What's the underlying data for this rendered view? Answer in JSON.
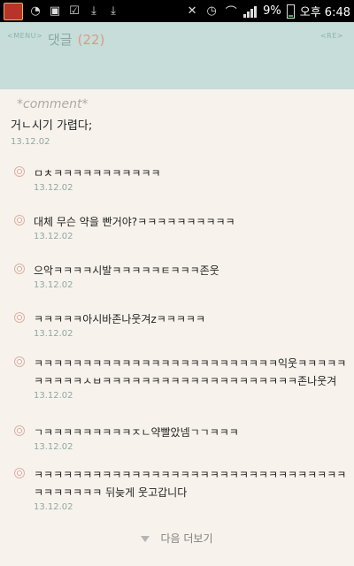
{
  "status_bar": {
    "battery": "9%",
    "time": "오후 6:48"
  },
  "header": {
    "menu_label": "<MENU>",
    "re_label": "<RE>",
    "title": "댓글",
    "count": "(22)"
  },
  "tab": {
    "label": "*comment*"
  },
  "main_post": {
    "text": "거ㄴ시기 가렵다;",
    "date": "13.12.02"
  },
  "replies": [
    {
      "text": "ㅁㅊㅋㅋㅋㅋㅋㅋㅋㅋㅋㅋㅋ",
      "date": "13.12.02"
    },
    {
      "text": "대체 무슨 약을 빤거야?ㅋㅋㅋㅋㅋㅋㅋㅋㅋㅋ",
      "date": "13.12.02"
    },
    {
      "text": "으악ㅋㅋㅋㅋ시발ㅋㅋㅋㅋㅋㅌㅋㅋㅋ존웃",
      "date": "13.12.02"
    },
    {
      "text": "ㅋㅋㅋㅋㅋ아시바존나웃겨zㅋㅋㅋㅋㅋ",
      "date": "13.12.02"
    },
    {
      "text": "ㅋㅋㅋㅋㅋㅋㅋㅋㅋㅋㅋㅋㅋㅋㅋㅋㅋㅋㅋㅋㅋㅋㅋㅋㅋ익웃ㅋㅋㅋㅋㅋㅋㅋㅋㅋㅋㅅㅂㅋㅋㅋㅋㅋㅋㅋㅋㅋㅋㅋㅋㅋㅋㅋㅋㅋㅋㅋㅋ존나웃겨",
      "date": "13.12.02"
    },
    {
      "text": "ㄱㅋㅋㅋㅋㅋㅋㅋㅋㅋㅈㄴ약빨았넴ㄱㄱㅋㅋㅋ",
      "date": "13.12.02"
    },
    {
      "text": "ㅋㅋㅋㅋㅋㅋㅋㅋㅋㅋㅋㅋㅋㅋㅋㅋㅋㅋㅋㅋㅋㅋㅋㅋㅋㅋㅋㅋㅋㅋㅋㅋㅋㅋㅋㅋㅋㅋㅋ 뒤늦게 웃고갑니다",
      "date": "13.12.02"
    }
  ],
  "more": {
    "label": "다음 더보기"
  }
}
